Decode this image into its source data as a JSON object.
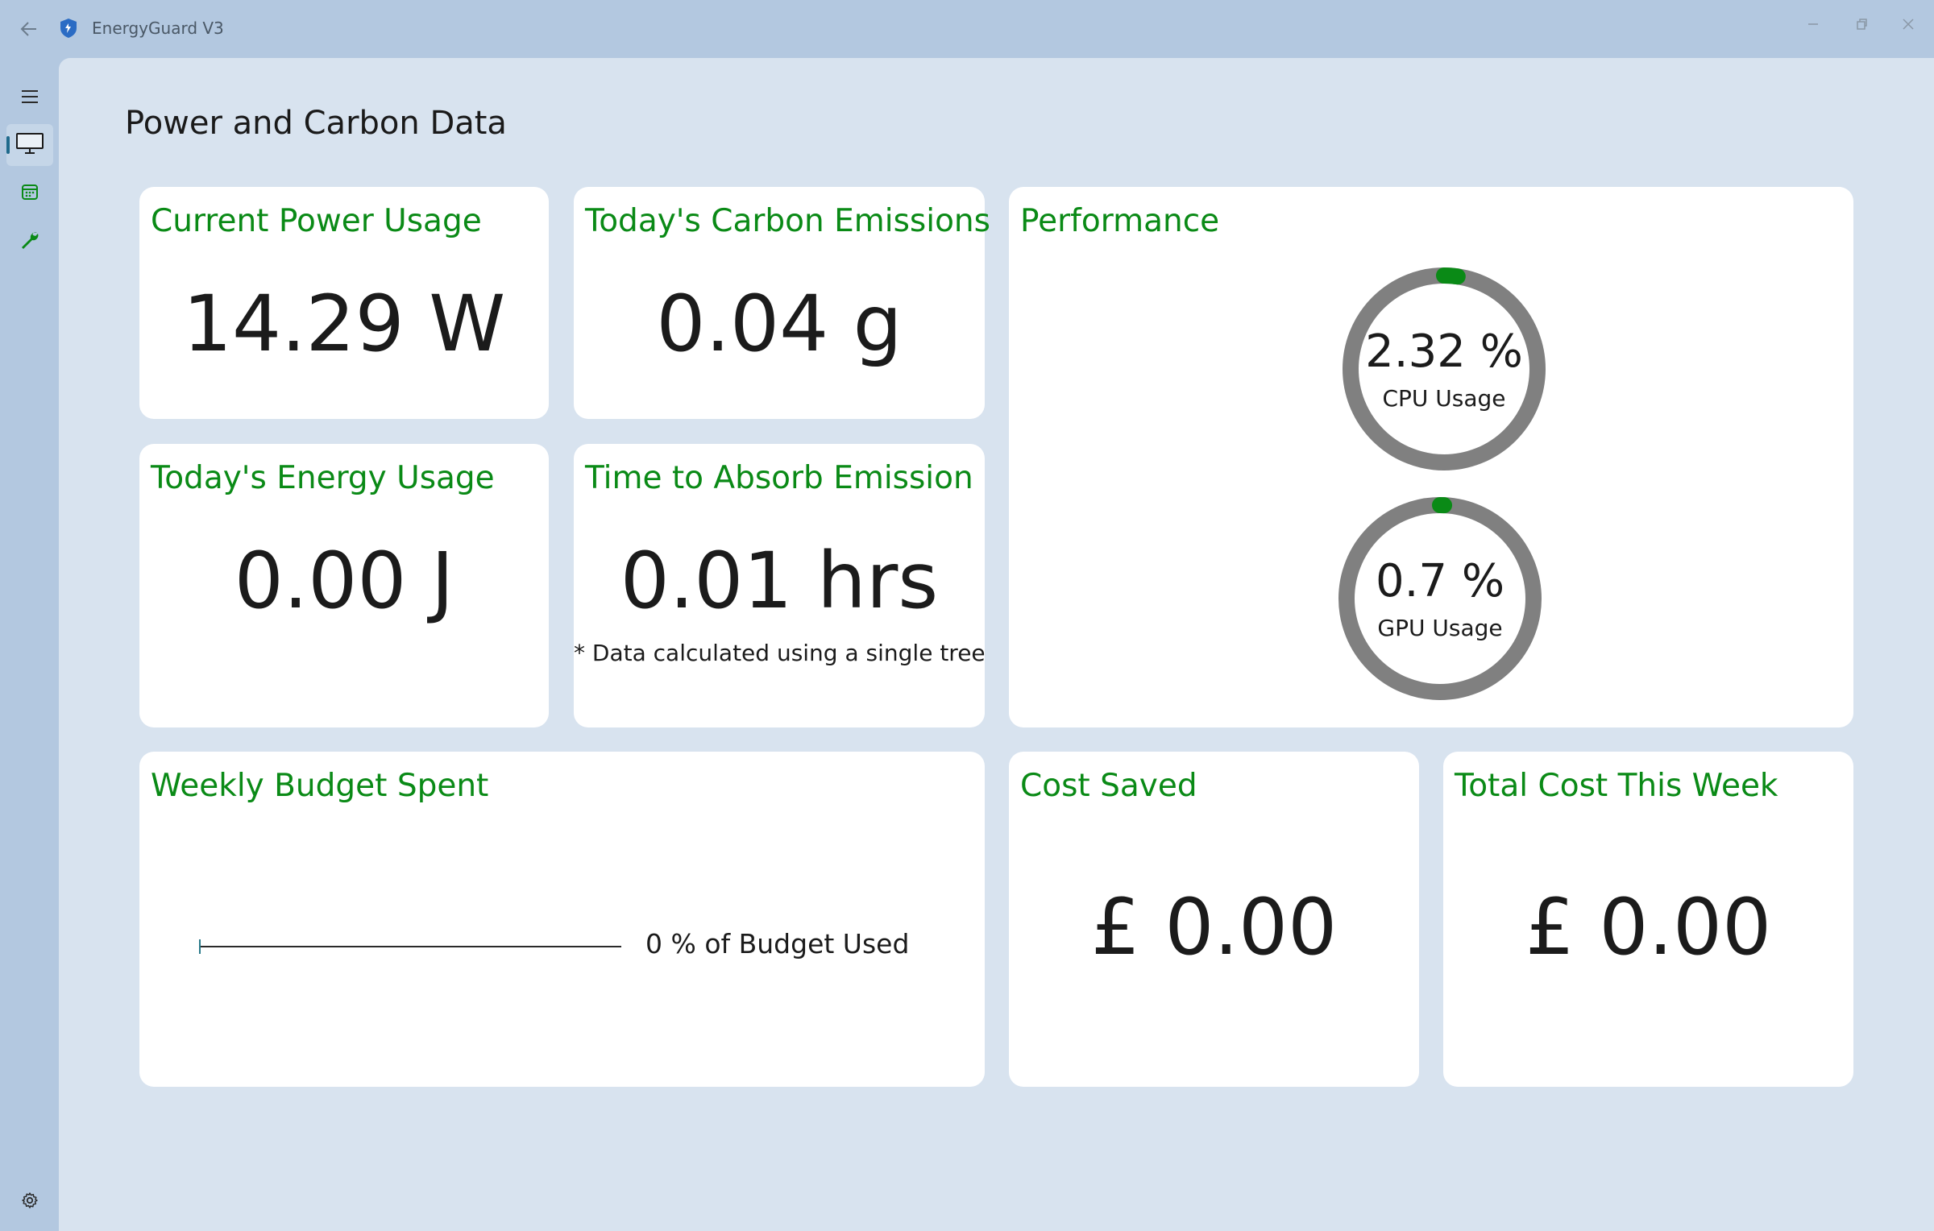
{
  "window": {
    "title": "EnergyGuard V3",
    "controls": [
      "minimize-icon",
      "restore-icon",
      "close-icon"
    ]
  },
  "sidebar": {
    "items": [
      {
        "icon": "hamburger-menu-icon"
      },
      {
        "icon": "monitor-icon",
        "active": true
      },
      {
        "icon": "calendar-icon"
      },
      {
        "icon": "wrench-icon"
      },
      {
        "icon": "gear-icon"
      }
    ]
  },
  "page": {
    "title": "Power and Carbon Data"
  },
  "cards": {
    "power": {
      "title": "Current Power Usage",
      "value": "14.29 W"
    },
    "carbon": {
      "title": "Today's Carbon Emissions",
      "value": "0.04 g"
    },
    "energy": {
      "title": "Today's Energy Usage",
      "value": "0.00 J"
    },
    "absorb": {
      "title": "Time to Absorb Emission",
      "value": "0.01 hrs",
      "note": "* Data calculated using a single tree"
    },
    "performance": {
      "title": "Performance",
      "cpu": {
        "value": "2.32 %",
        "label": "CPU Usage",
        "percent": 2.32
      },
      "gpu": {
        "value": "0.7 %",
        "label": "GPU Usage",
        "percent": 0.7
      }
    },
    "budget": {
      "title": "Weekly Budget Spent",
      "text": "0 % of Budget Used",
      "percent": 0
    },
    "cost_saved": {
      "title": "Cost Saved",
      "value": "£ 0.00"
    },
    "total_cost": {
      "title": "Total Cost This Week",
      "value": "£ 0.00"
    }
  },
  "colors": {
    "accent_green": "#0a8a16",
    "ring_track": "#808080",
    "background": "#d8e3ef",
    "chrome": "#b3c8e0"
  }
}
